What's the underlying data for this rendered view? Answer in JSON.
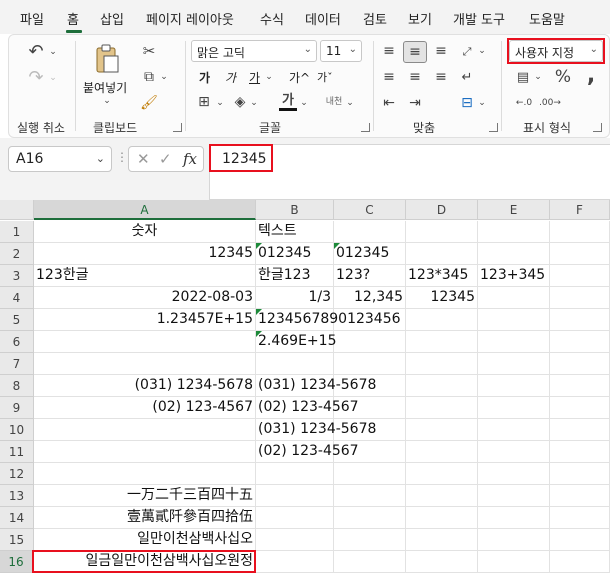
{
  "menu": {
    "tabs": [
      "파일",
      "홈",
      "삽입",
      "페이지 레이아웃",
      "수식",
      "데이터",
      "검토",
      "보기",
      "개발 도구",
      "도움말"
    ],
    "active_tab": "홈"
  },
  "ribbon": {
    "groups": {
      "undo": "실행 취소",
      "clipboard": "클립보드",
      "font": "글꼴",
      "align": "맞춤",
      "number": "표시 형식"
    },
    "paste_label": "붙여넣기",
    "font_name": "맑은 고딕",
    "font_size": "11",
    "number_format": "사용자 지정",
    "font_buttons": [
      "가",
      "가",
      "가",
      "가^",
      "가ˇ"
    ],
    "accent_color": "#1e6e3b",
    "highlight_color": "#e8101e"
  },
  "formula_bar": {
    "name_box": "A16",
    "content": "12345",
    "fx": "fx"
  },
  "sheet": {
    "columns": [
      "A",
      "B",
      "C",
      "D",
      "E",
      "F"
    ],
    "rows": [
      "1",
      "2",
      "3",
      "4",
      "5",
      "6",
      "7",
      "8",
      "9",
      "10",
      "11",
      "12",
      "13",
      "14",
      "15",
      "16"
    ],
    "cells": {
      "A1": "숫자",
      "B1": "텍스트",
      "A2": "12345",
      "B2": "012345",
      "C2": "012345",
      "A3": "123한글",
      "B3": "한글123",
      "C3": "123?",
      "D3": "123*345",
      "E3": "123+345",
      "A4": "2022-08-03",
      "B4": "1/3",
      "C4": "12,345",
      "D4": "12345",
      "A5": "1.23457E+15",
      "B5": "1234567890123456",
      "B6": "2.469E+15",
      "A8": "(031) 1234-5678",
      "B8": "(031) 1234-5678",
      "A9": "(02) 123-4567",
      "B9": "(02) 123-4567",
      "B10": "(031) 1234-5678",
      "B11": "(02) 123-4567",
      "A13": "一万二千三百四十五",
      "A14": "壹萬貳阡參百四拾伍",
      "A15": "일만이천삼백사십오",
      "A16": "일금일만이천삼백사십오원정"
    },
    "selected_cell": "A16"
  }
}
